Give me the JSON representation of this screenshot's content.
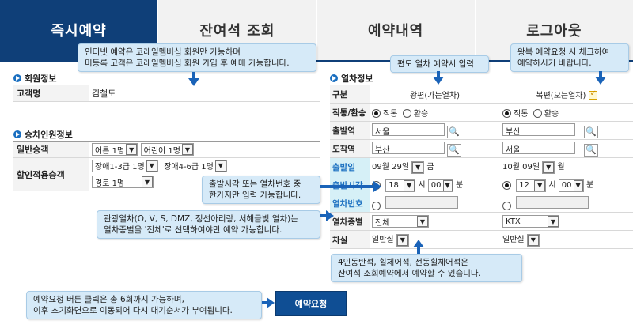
{
  "nav": {
    "tabs": [
      "즉시예약",
      "잔여석 조회",
      "예약내역",
      "로그아웃"
    ]
  },
  "member": {
    "title": "회원정보",
    "name_label": "고객명",
    "name_value": "김철도"
  },
  "passengers": {
    "title": "승차인원정보",
    "general_label": "일반승객",
    "adult": "어른 1명",
    "child": "어린이 1명",
    "discount_label": "할인적용승객",
    "disabled13": "장애1-3급 1명",
    "disabled46": "장애4-6급 1명",
    "senior": "경로 1명"
  },
  "train": {
    "title": "열차정보",
    "col_label": "구분",
    "col_out": "왕편(가는열차)",
    "col_return": "복편(오는열차)",
    "trip_label": "직통/환승",
    "direct": "직통",
    "transfer": "환승",
    "dep_label": "출발역",
    "dep_out": "서울",
    "dep_return": "부산",
    "arr_label": "도착역",
    "arr_out": "부산",
    "arr_return": "서울",
    "date_label": "출발일",
    "date_out_md": "09월 29일",
    "date_out_day": "금",
    "date_ret_md": "10월 09일",
    "date_ret_day": "월",
    "time_label": "출발시각",
    "hour_out": "18",
    "min_out": "00",
    "hour_ret": "12",
    "min_ret": "00",
    "hour_unit": "시",
    "min_unit": "분",
    "trainno_label": "열차번호",
    "type_label": "열차종별",
    "type_out": "전체",
    "type_ret": "KTX",
    "seat_label": "차실",
    "seat_out": "일반실",
    "seat_ret": "일반실"
  },
  "callouts": {
    "membership": "인터넷 예약은 코레일멤버십 회원만 가능하며\n미등록 고객은 코레일멤버십 회원 가입 후 예매 가능합니다.",
    "oneway": "편도 열차 예약시 입력",
    "roundtrip": "왕복 예약요청 시 체크하여\n예약하시기 바랍니다.",
    "time_or_no": "출발시각 또는 열차번호 중\n한가지만 입력 가능합니다.",
    "tourist": "관광열차(O, V, S, DMZ, 정선아리랑, 서해금빛 열차)는\n열차종별을 '전체'로 선택하여야만 예약 가능합니다.",
    "seat_type": "4인동반석, 휠체어석, 전동휠체어석은\n잔여석 조회예약에서 예약할 수 있습니다.",
    "request": "예약요청 버튼 클릭은 총 6회까지 가능하며,\n이후 초기화면으로 이동되어 다시 대기순서가 부여됩니다."
  },
  "reserve_button": "예약요청"
}
